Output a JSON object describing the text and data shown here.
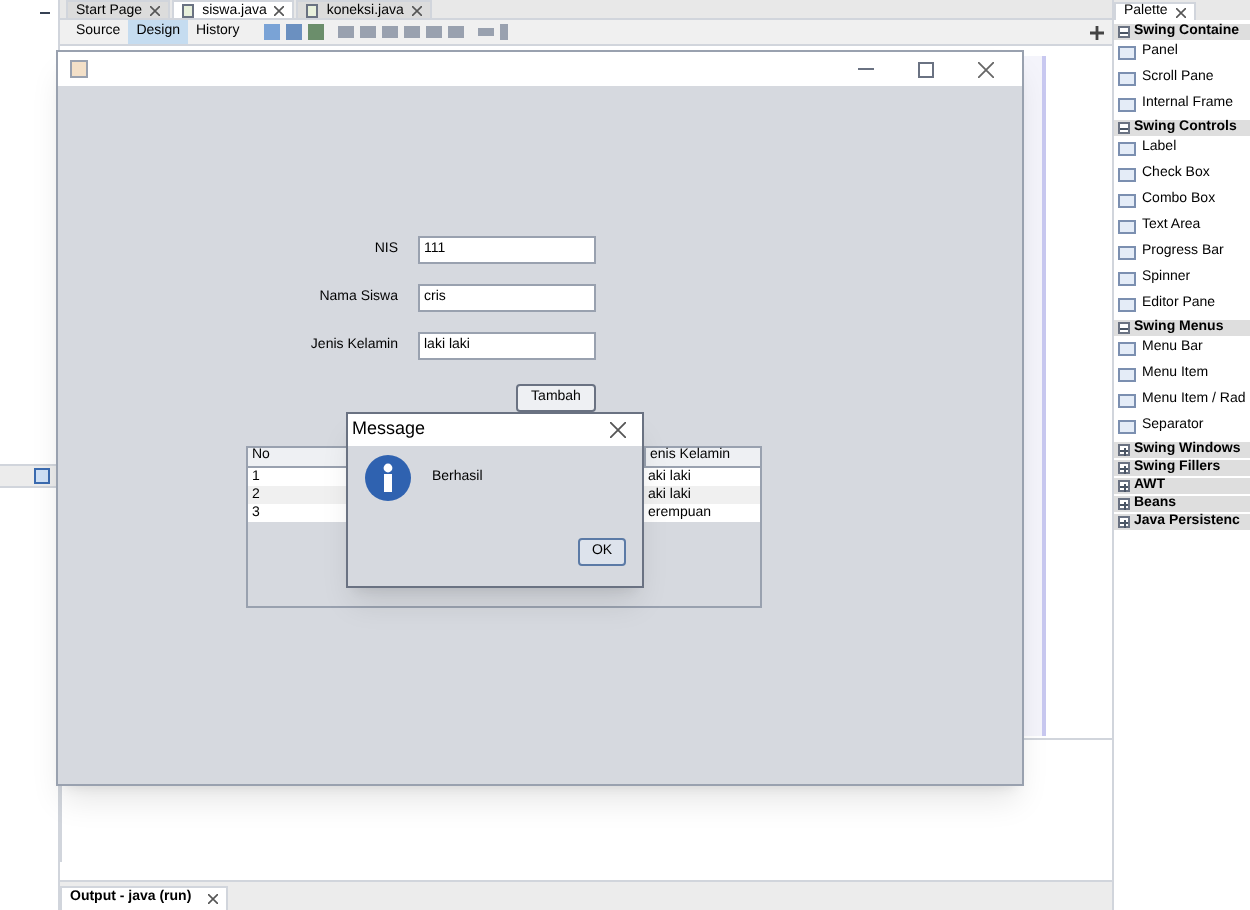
{
  "editor_tabs": [
    {
      "label": "Start Page",
      "selected": false
    },
    {
      "label": "siswa.java",
      "selected": true
    },
    {
      "label": "koneksi.java",
      "selected": false
    }
  ],
  "view_tabs": [
    {
      "label": "Source",
      "selected": false
    },
    {
      "label": "Design",
      "selected": true
    },
    {
      "label": "History",
      "selected": false
    }
  ],
  "palette": {
    "title": "Palette",
    "sections": [
      {
        "label": "Swing Containe",
        "expanded": true,
        "items": [
          "Panel",
          "Scroll Pane",
          "Internal Frame"
        ]
      },
      {
        "label": "Swing Controls",
        "expanded": true,
        "items": [
          "Label",
          "Check Box",
          "Combo Box",
          "Text Area",
          "Progress Bar",
          "Spinner",
          "Editor Pane"
        ]
      },
      {
        "label": "Swing Menus",
        "expanded": true,
        "items": [
          "Menu Bar",
          "Menu Item",
          "Menu Item / Rad",
          "Separator"
        ]
      },
      {
        "label": "Swing Windows",
        "expanded": false
      },
      {
        "label": "Swing Fillers",
        "expanded": false
      },
      {
        "label": "AWT",
        "expanded": false
      },
      {
        "label": "Beans",
        "expanded": false
      },
      {
        "label": "Java Persistenc",
        "expanded": false
      }
    ]
  },
  "output_tab": {
    "label": "Output - java (run)"
  },
  "app": {
    "fields": [
      {
        "label": "NIS",
        "value": "111"
      },
      {
        "label": "Nama Siswa",
        "value": "cris"
      },
      {
        "label": "Jenis Kelamin",
        "value": "laki laki"
      }
    ],
    "button": "Tambah",
    "table": {
      "columns": [
        "No",
        "enis Kelamin"
      ],
      "rows": [
        [
          "1",
          "aki laki"
        ],
        [
          "2",
          "aki laki"
        ],
        [
          "3",
          "erempuan"
        ]
      ]
    }
  },
  "dialog": {
    "title": "Message",
    "message": "Berhasil",
    "button": "OK"
  }
}
